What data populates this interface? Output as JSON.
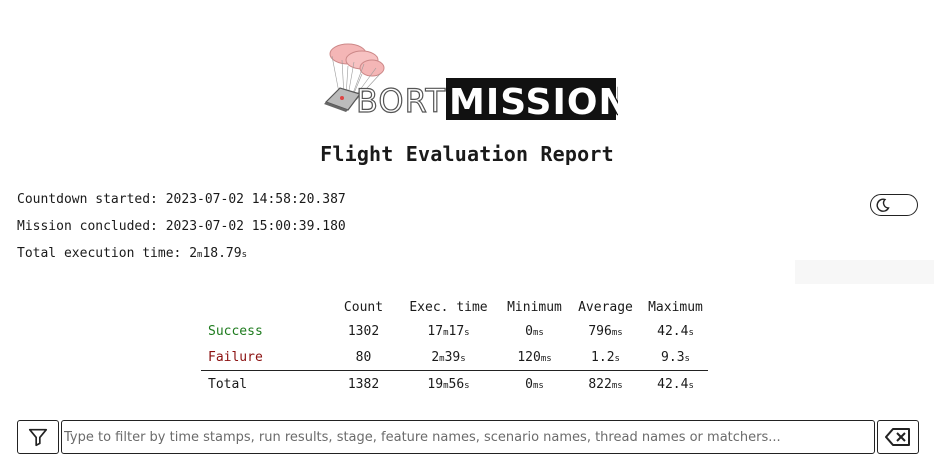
{
  "logo": {
    "text_left": "BORT",
    "text_right": "MISSION"
  },
  "title": "Flight Evaluation Report",
  "meta": {
    "countdown_label": "Countdown started:",
    "countdown_value": "2023-07-02 14:58:20.387",
    "concluded_label": "Mission concluded:",
    "concluded_value": "2023-07-02 15:00:39.180",
    "exec_label": "Total execution time:",
    "exec_value": {
      "m": "2",
      "m_unit": "m",
      "s": "18.79",
      "s_unit": "s"
    }
  },
  "theme_toggle": {
    "icon": "moon-icon"
  },
  "stats": {
    "headers": [
      "",
      "Count",
      "Exec. time",
      "Minimum",
      "Average",
      "Maximum"
    ],
    "rows": [
      {
        "label": "Success",
        "count": "1302",
        "exec": [
          "17",
          "m",
          "17",
          "s"
        ],
        "min": [
          "0",
          "ms"
        ],
        "avg": [
          "796",
          "ms"
        ],
        "max": [
          "42.4",
          "s"
        ]
      },
      {
        "label": "Failure",
        "count": "80",
        "exec": [
          "2",
          "m",
          "39",
          "s"
        ],
        "min": [
          "120",
          "ms"
        ],
        "avg": [
          "1.2",
          "s"
        ],
        "max": [
          "9.3",
          "s"
        ]
      },
      {
        "label": "Total",
        "count": "1382",
        "exec": [
          "19",
          "m",
          "56",
          "s"
        ],
        "min": [
          "0",
          "ms"
        ],
        "avg": [
          "822",
          "ms"
        ],
        "max": [
          "42.4",
          "s"
        ]
      }
    ]
  },
  "filter": {
    "placeholder": "Type to filter by time stamps, run results, stage, feature names, scenario names, thread names or matchers...",
    "value": "",
    "filter_icon": "filter-icon",
    "clear_icon": "backspace-icon"
  },
  "colors": {
    "success": "#1e7b1e",
    "failure": "#8b1010",
    "parachute": "#f4b6b6"
  }
}
